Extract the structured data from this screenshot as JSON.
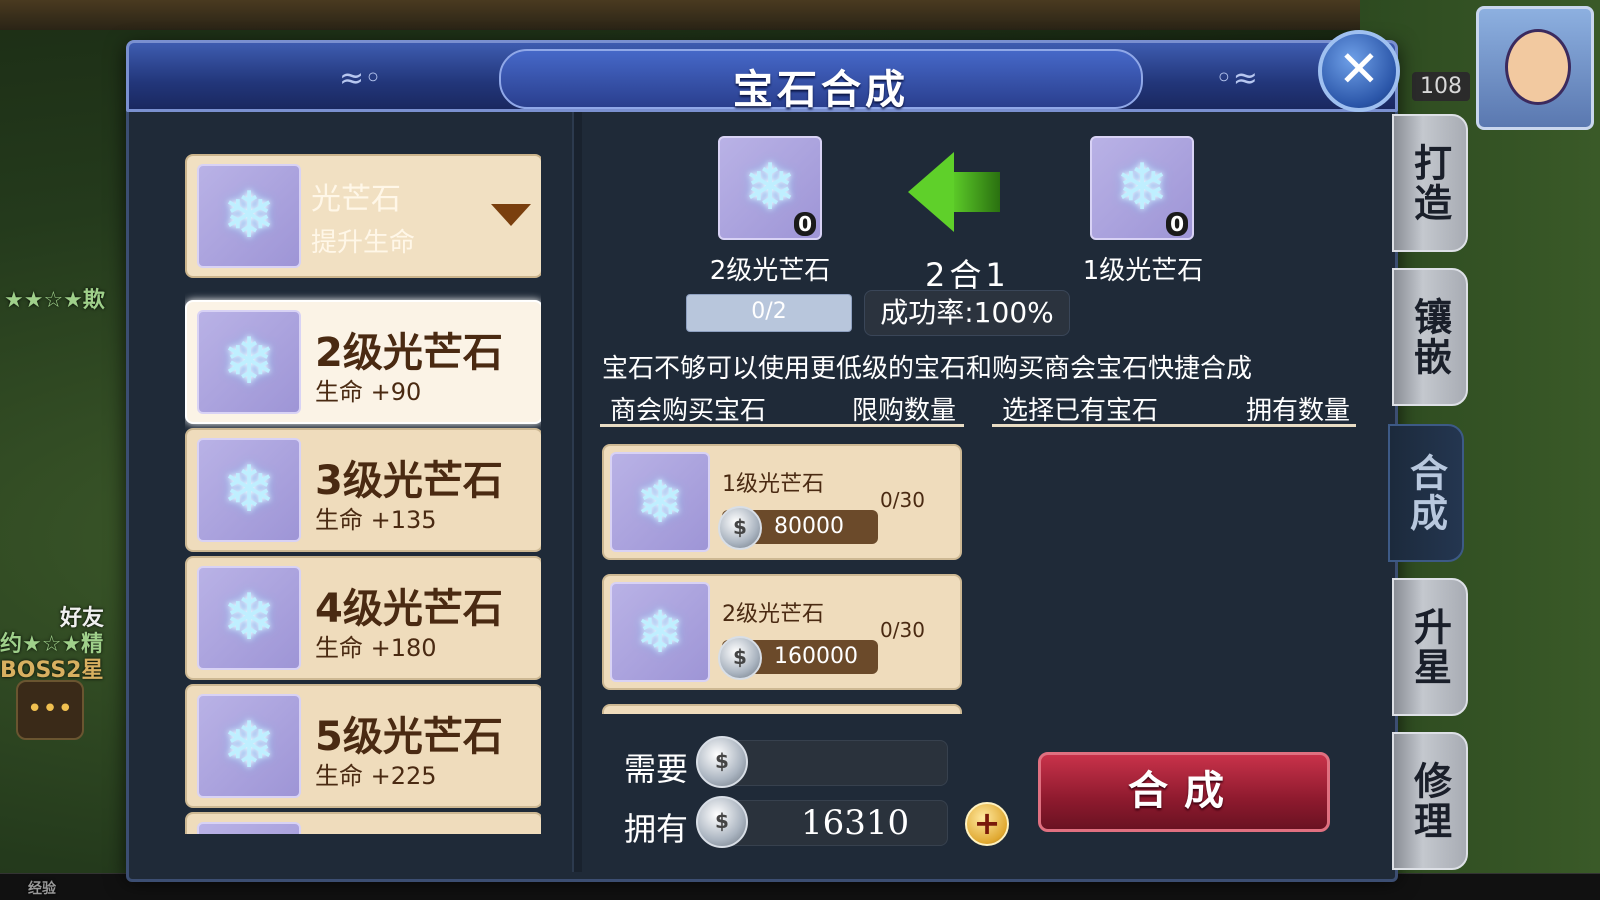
{
  "window": {
    "title": "宝石合成",
    "close_glyph": "✕"
  },
  "background": {
    "texts": [
      "★★☆★欺",
      "好友",
      "约★☆★精",
      "BOSS2星",
      "经验"
    ],
    "level": "108",
    "chat_glyph": "•••"
  },
  "gem_selector": {
    "name": "光芒石",
    "desc": "提升生命"
  },
  "gem_list": [
    {
      "name": "2级光芒石",
      "stat": "生命 +90",
      "selected": true
    },
    {
      "name": "3级光芒石",
      "stat": "生命 +135",
      "selected": false
    },
    {
      "name": "4级光芒石",
      "stat": "生命 +180",
      "selected": false
    },
    {
      "name": "5级光芒石",
      "stat": "生命 +225",
      "selected": false
    }
  ],
  "synthesis": {
    "target": {
      "name": "2级光芒石",
      "count": "0"
    },
    "source": {
      "name": "1级光芒石",
      "count": "0"
    },
    "ratio": "2合1",
    "progress_text": "0/2",
    "progress_fraction": 0,
    "success_rate": "成功率:100%",
    "hint": "宝石不够可以使用更低级的宝石和购买商会宝石快捷合成"
  },
  "headers": {
    "shop": "商会购买宝石",
    "limit": "限购数量",
    "owned_select": "选择已有宝石",
    "owned_count": "拥有数量"
  },
  "shop_items": [
    {
      "name": "1级光芒石",
      "price": "80000",
      "limit": "0/30"
    },
    {
      "name": "2级光芒石",
      "price": "160000",
      "limit": "0/30"
    }
  ],
  "cost": {
    "need_label": "需要",
    "have_label": "拥有",
    "need_value": "",
    "have_value": "16310",
    "plus_glyph": "+"
  },
  "buttons": {
    "synthesize": "合成"
  },
  "side_tabs": [
    {
      "label": "打造",
      "active": false
    },
    {
      "label": "镶嵌",
      "active": false
    },
    {
      "label": "合成",
      "active": true
    },
    {
      "label": "升星",
      "active": false
    },
    {
      "label": "修理",
      "active": false
    }
  ],
  "icons": {
    "gem": "gem-icon",
    "coin": "silver-coin-icon",
    "arrow": "green-left-arrow-icon"
  },
  "colors": {
    "title_bar": "#2a3f8e",
    "panel": "#1f2a38",
    "card": "#efdcbc",
    "synth_button": "#8e1a2e",
    "arrow": "#5fd02a"
  }
}
